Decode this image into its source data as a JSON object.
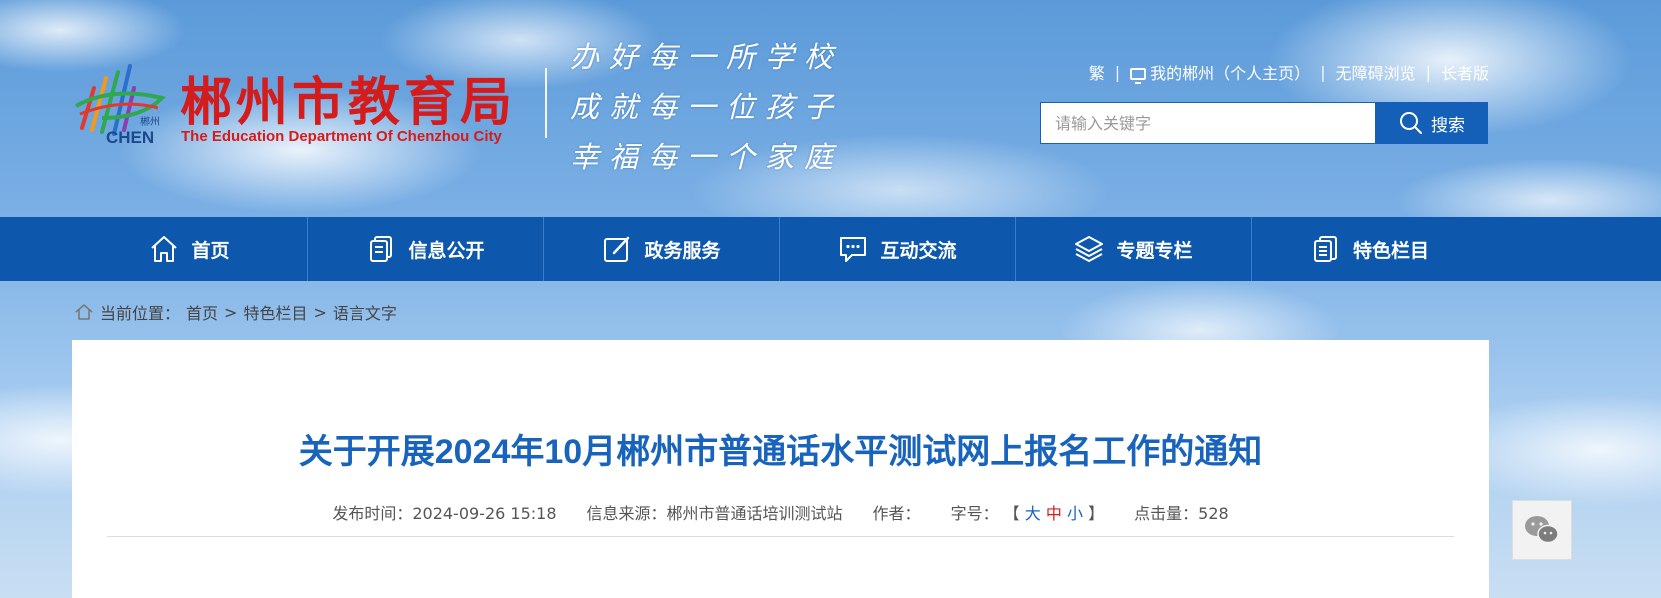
{
  "header": {
    "logo_cn": "郴州市教育局",
    "logo_en": "The Education Department Of Chenzhou City",
    "logo_mark_text": "CHEN",
    "logo_mark_cn": "郴州",
    "motto": [
      "办好每一所学校",
      "成就每一位孩子",
      "幸福每一个家庭"
    ]
  },
  "toplinks": {
    "traditional": "繁",
    "my_chenzhou": "我的郴州（个人主页）",
    "accessible": "无障碍浏览",
    "elder": "长者版",
    "separator": "|"
  },
  "search": {
    "placeholder": "请输入关键字",
    "button_label": "搜索"
  },
  "nav": {
    "items": [
      {
        "label": "首页",
        "icon": "home-icon"
      },
      {
        "label": "信息公开",
        "icon": "document-icon"
      },
      {
        "label": "政务服务",
        "icon": "edit-icon"
      },
      {
        "label": "互动交流",
        "icon": "chat-icon"
      },
      {
        "label": "专题专栏",
        "icon": "layers-icon"
      },
      {
        "label": "特色栏目",
        "icon": "list-icon"
      }
    ]
  },
  "breadcrumb": {
    "prefix": "当前位置：",
    "items": [
      "首页",
      "特色栏目",
      "语言文字"
    ],
    "separator": ">"
  },
  "article": {
    "title": "关于开展2024年10月郴州市普通话水平测试网上报名工作的通知",
    "publish_label": "发布时间：",
    "publish_time": "2024-09-26 15:18",
    "source_label": "信息来源：",
    "source": "郴州市普通话培训测试站",
    "author_label": "作者：",
    "author": "",
    "fontsize_label": "字号：",
    "bracket_open": "【",
    "bracket_close": "】",
    "size_big": "大",
    "size_mid": "中",
    "size_small": "小",
    "clicks_label": "点击量：",
    "clicks": "528"
  },
  "colors": {
    "nav_bg": "#0d57ad",
    "title": "#1863bc",
    "logo_red": "#d51c1c"
  }
}
